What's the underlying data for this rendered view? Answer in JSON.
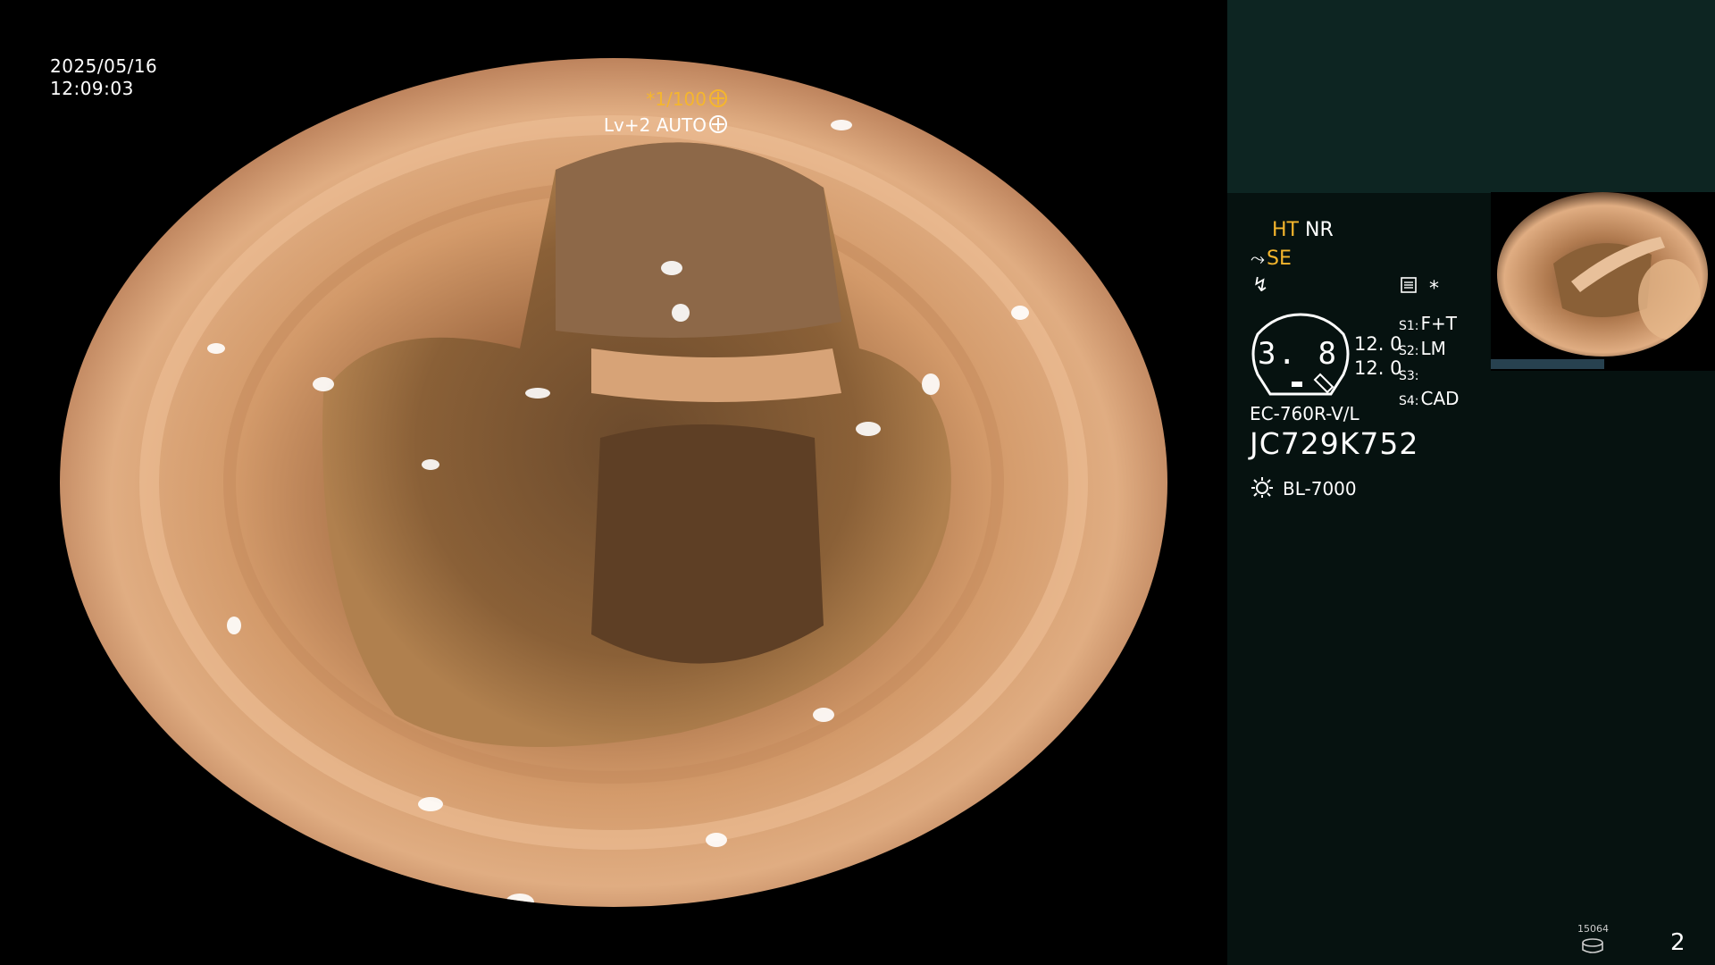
{
  "overlay": {
    "date": "2025/05/16",
    "time": "12:09:03",
    "shutter": "*1/100",
    "iris": "Lv+2 AUTO"
  },
  "panel": {
    "ht": "HT",
    "nr": "NR",
    "se": "SE",
    "gauge_value": "3. 8",
    "gauge_num_1": "12. 0",
    "gauge_num_2": "12. 0",
    "switches": [
      {
        "key": "S1:",
        "value": "F+T"
      },
      {
        "key": "S2:",
        "value": "LM"
      },
      {
        "key": "S3:",
        "value": ""
      },
      {
        "key": "S4:",
        "value": "CAD"
      }
    ],
    "scope_model": "EC-760R-V/L",
    "serial": "JC729K752",
    "light_source": "BL-7000",
    "star": "*"
  },
  "footer": {
    "counter": "15064",
    "page": "2"
  },
  "colors": {
    "amber": "#f5b62d",
    "panel_bg": "#061210",
    "panel_top_bg": "#0d2522"
  }
}
